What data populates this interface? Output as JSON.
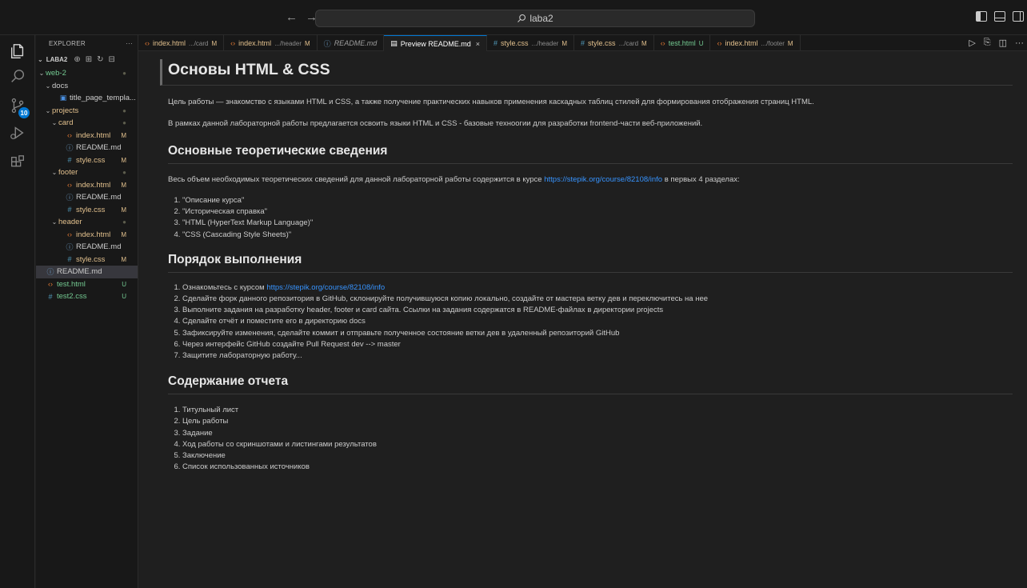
{
  "titlebar": {
    "back": "←",
    "forward": "→",
    "search_text": "laba2"
  },
  "activity": {
    "scm_badge": "10"
  },
  "sidebar": {
    "title": "EXPLORER",
    "more": "···",
    "root_label": "LABA2",
    "tree": [
      {
        "depth": 0,
        "kind": "folder",
        "label": "web-2",
        "status": "●",
        "cls": "c-unt"
      },
      {
        "depth": 1,
        "kind": "folder",
        "label": "docs",
        "status": "",
        "cls": ""
      },
      {
        "depth": 2,
        "kind": "doc",
        "label": "title_page_templa...",
        "status": "",
        "cls": ""
      },
      {
        "depth": 1,
        "kind": "folder",
        "label": "projects",
        "status": "●",
        "cls": "c-mod"
      },
      {
        "depth": 2,
        "kind": "folder",
        "label": "card",
        "status": "●",
        "cls": "c-mod"
      },
      {
        "depth": 3,
        "kind": "html",
        "label": "index.html",
        "status": "M",
        "cls": "c-mod"
      },
      {
        "depth": 3,
        "kind": "info",
        "label": "README.md",
        "status": "",
        "cls": ""
      },
      {
        "depth": 3,
        "kind": "css",
        "label": "style.css",
        "status": "M",
        "cls": "c-mod"
      },
      {
        "depth": 2,
        "kind": "folder",
        "label": "footer",
        "status": "●",
        "cls": "c-mod"
      },
      {
        "depth": 3,
        "kind": "html",
        "label": "index.html",
        "status": "M",
        "cls": "c-mod"
      },
      {
        "depth": 3,
        "kind": "info",
        "label": "README.md",
        "status": "",
        "cls": ""
      },
      {
        "depth": 3,
        "kind": "css",
        "label": "style.css",
        "status": "M",
        "cls": "c-mod"
      },
      {
        "depth": 2,
        "kind": "folder",
        "label": "header",
        "status": "●",
        "cls": "c-mod"
      },
      {
        "depth": 3,
        "kind": "html",
        "label": "index.html",
        "status": "M",
        "cls": "c-mod"
      },
      {
        "depth": 3,
        "kind": "info",
        "label": "README.md",
        "status": "",
        "cls": ""
      },
      {
        "depth": 3,
        "kind": "css",
        "label": "style.css",
        "status": "M",
        "cls": "c-mod"
      },
      {
        "depth": 0,
        "kind": "info",
        "label": "README.md",
        "status": "",
        "cls": "",
        "selected": true
      },
      {
        "depth": 0,
        "kind": "html",
        "label": "test.html",
        "status": "U",
        "cls": "c-unt"
      },
      {
        "depth": 0,
        "kind": "css",
        "label": "test2.css",
        "status": "U",
        "cls": "c-unt"
      }
    ]
  },
  "tabs": [
    {
      "icon": "html",
      "name": "index.html",
      "path": ".../card",
      "status": "M",
      "cls": "c-mod"
    },
    {
      "icon": "html",
      "name": "index.html",
      "path": ".../header",
      "status": "M",
      "cls": "c-mod"
    },
    {
      "icon": "info",
      "name": "README.md",
      "path": "",
      "status": "",
      "cls": "",
      "italic": true
    },
    {
      "icon": "preview",
      "name": "Preview README.md",
      "path": "",
      "status": "",
      "cls": "",
      "active": true,
      "close": "×"
    },
    {
      "icon": "css",
      "name": "style.css",
      "path": ".../header",
      "status": "M",
      "cls": "c-mod"
    },
    {
      "icon": "css",
      "name": "style.css",
      "path": ".../card",
      "status": "M",
      "cls": "c-mod"
    },
    {
      "icon": "html",
      "name": "test.html",
      "path": "",
      "status": "U",
      "cls": "c-unt"
    },
    {
      "icon": "html",
      "name": "index.html",
      "path": ".../footer",
      "status": "M",
      "cls": "c-mod"
    }
  ],
  "tab_actions": [
    "▷",
    "⎘",
    "◫",
    "···"
  ],
  "doc": {
    "h1": "Основы HTML & CSS",
    "p1": "Цель работы — знакомство с языками HTML и CSS, а также получение практических навыков применения каскадных таблиц стилей для формирования отображения страниц HTML.",
    "p2": "В рамках данной лабораторной работы предлагается освоить языки HTML и CSS - базовые техноогии для разработки frontend-части веб-приложений.",
    "h2_theory": "Основные теоретические сведения",
    "theory_text_before": "Весь объем необходимых теоретических сведений для данной лабораторной работы содержится в курсе ",
    "theory_link": "https://stepik.org/course/82108/info",
    "theory_text_after": " в первых 4 разделах:",
    "theory_list": [
      "\"Описание курса\"",
      "\"Историческая справка\"",
      "\"HTML (HyperText Markup Language)\"",
      "\"CSS (Cascading Style Sheets)\""
    ],
    "h2_order": "Порядок выполнения",
    "order_first_text": "Ознакомьтесь с курсом ",
    "order_first_link": "https://stepik.org/course/82108/info",
    "order_list": [
      "Сделайте форк данного репозитория в GitHub, склонируйте получившуюся копию локально, создайте от мастера ветку дев и переключитесь на нее",
      "Выполните задания на разработку header, footer и card сайта. Ссылки на задания содержатся в README-файлах в директории projects",
      "Сделайте отчёт и поместите его в директорию docs",
      "Зафиксируйте изменения, сделайте коммит и отправьте полученное состояние ветки дев в удаленный репозиторий GitHub",
      "Через интерфейс GitHub создайте Pull Request dev --> master",
      "Защитите лабораторную работу..."
    ],
    "h2_report": "Содержание отчета",
    "report_list": [
      "Титульный лист",
      "Цель работы",
      "Задание",
      "Ход работы со скриншотами и листингами результатов",
      "Заключение",
      "Список использованных источников"
    ]
  }
}
